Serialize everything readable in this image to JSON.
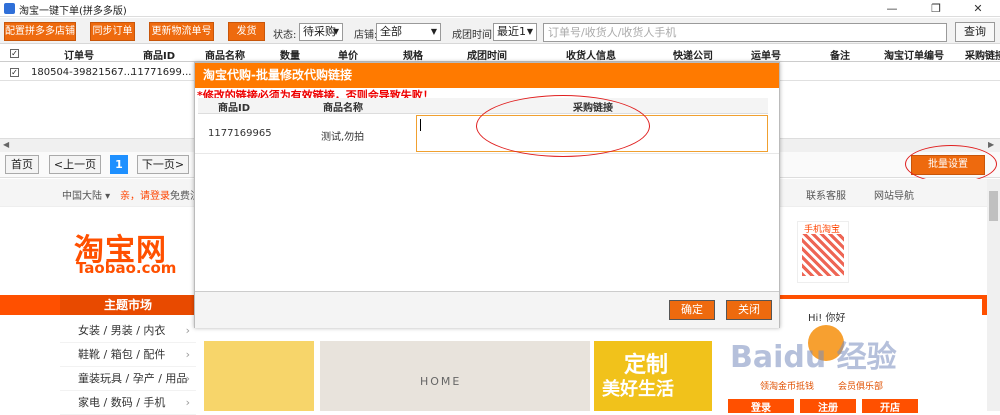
{
  "window": {
    "title": "淘宝一键下单(拼多多版)",
    "min": "—",
    "max": "❐",
    "close": "✕"
  },
  "toolbar": {
    "btn_config": "配置拼多多店铺",
    "btn_sync": "同步订单",
    "btn_update": "更新物流单号",
    "btn_ship": "发货",
    "status_label": "状态:",
    "status_value": "待采购",
    "shop_label": "店铺:",
    "shop_value": "全部",
    "time_label": "成团时间:",
    "time_value": "最近1",
    "search_placeholder": "订单号/收货人/收货人手机",
    "query": "查询"
  },
  "table": {
    "headers": [
      "订单号",
      "商品ID",
      "商品名称",
      "数量",
      "单价",
      "规格",
      "成团时间",
      "收货人信息",
      "快递公司",
      "运单号",
      "备注",
      "淘宝订单编号",
      "采购链接"
    ],
    "row": {
      "order": "180504-39821567...",
      "goods_id": "11771699..."
    }
  },
  "pager": {
    "first": "首页",
    "prev": "<上一页",
    "current": "1",
    "next": "下一页>"
  },
  "batch_button": "批量设置",
  "dialog": {
    "title": "淘宝代购-批量修改代购链接",
    "warning": "*修改的链接必须为有效链接，否则会导致失败！",
    "col_id": "商品ID",
    "col_name": "商品名称",
    "col_link": "采购链接",
    "row_id": "1177169965",
    "row_name": "测试,勿拍",
    "ok": "确定",
    "close": "关闭"
  },
  "taobao": {
    "region": "中国大陆 ▾",
    "login": "亲，请登录",
    "free": "免费注",
    "service": "联系客服",
    "sitenav": "网站导航",
    "logo": "淘宝网",
    "logo_en": "Taobao.com",
    "mobile": "手机淘宝",
    "theme": "主题市场",
    "categories": [
      "女装 / 男装 / 内衣",
      "鞋靴 / 箱包 / 配件",
      "童装玩具 / 孕产 / 用品",
      "家电 / 数码 / 手机"
    ],
    "banner_home": "HOME",
    "banner_dz1": "定制",
    "banner_dz2": "美好生活",
    "hi": "Hi! 你好",
    "club1": "领淘金币抵钱",
    "club2": "会员俱乐部",
    "login_btn": "登录",
    "reg_btn": "注册",
    "open_btn": "开店",
    "watermark": "Baidu 经验"
  }
}
